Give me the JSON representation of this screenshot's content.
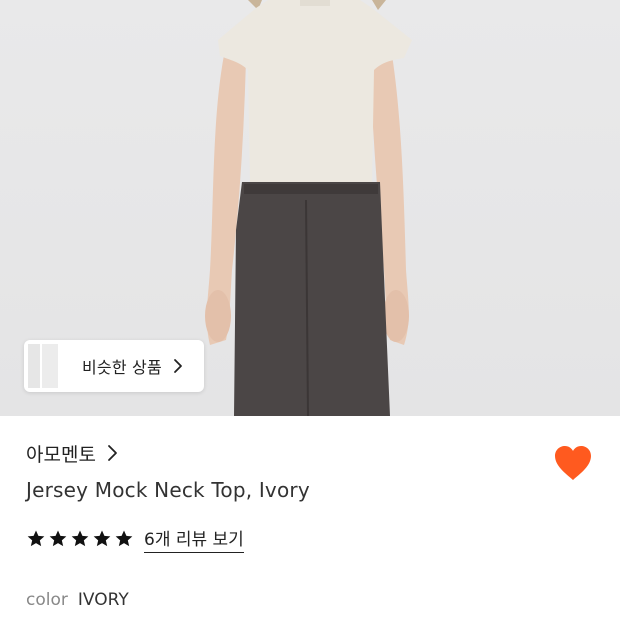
{
  "similar_products": {
    "label": "비슷한 상품"
  },
  "brand": {
    "name": "아모멘토"
  },
  "product": {
    "title": "Jersey Mock Neck Top, Ivory"
  },
  "rating": {
    "stars": 5,
    "review_link": "6개 리뷰 보기"
  },
  "option": {
    "label": "color",
    "value": "IVORY"
  },
  "colors": {
    "accent_heart": "#ff5a1f",
    "star": "#111111"
  },
  "icons": {
    "similar_chevron": "chevron-right-icon",
    "brand_chevron": "chevron-right-icon",
    "wishlist": "heart-icon",
    "rating": "star-icon"
  }
}
